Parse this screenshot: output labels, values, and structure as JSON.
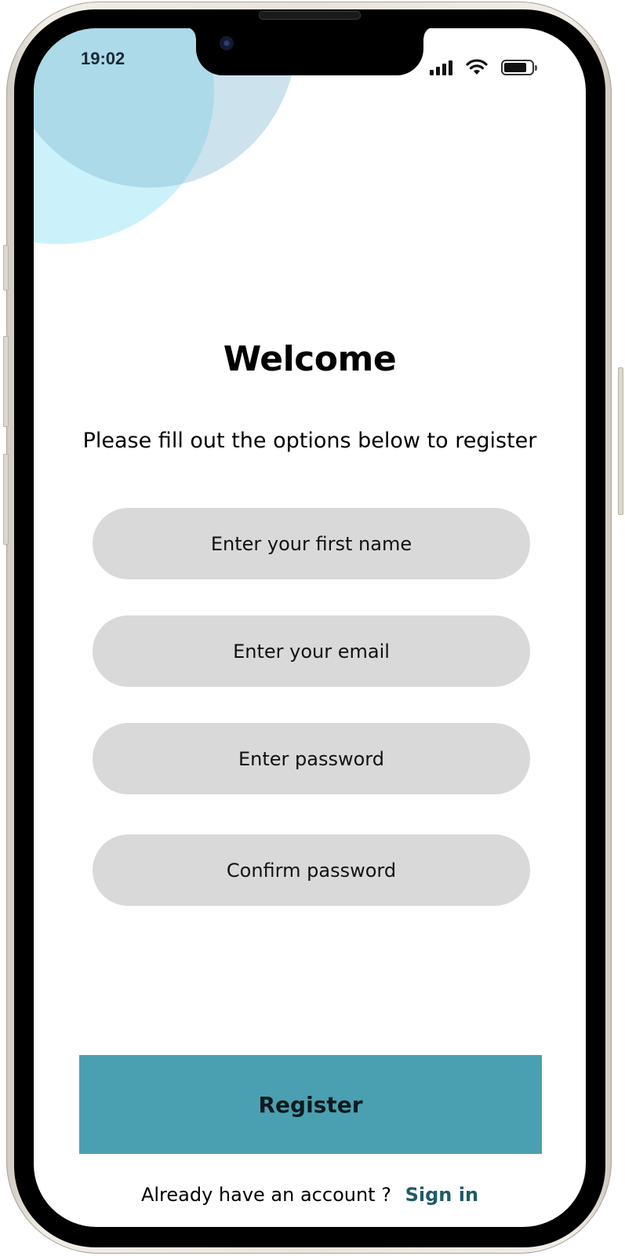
{
  "status_bar": {
    "time": "19:02",
    "signal_icon": "cellular-signal-icon",
    "wifi_icon": "wifi-icon",
    "battery_icon": "battery-icon"
  },
  "heading": "Welcome",
  "subheading": "Please fill out the options below to register",
  "fields": {
    "first_name": "Enter your first name",
    "email": "Enter your email",
    "password": "Enter password",
    "confirm_password": "Confirm password"
  },
  "register_label": "Register",
  "footer": {
    "prompt": "Already have an account ?",
    "signin_label": "Sign in"
  },
  "colors": {
    "accent": "#4aa0b0",
    "link": "#1e5a6a",
    "field_bg": "#d9d9d9",
    "bubble_light": "#a0e8f5",
    "bubble_dark": "#78b4ce"
  }
}
